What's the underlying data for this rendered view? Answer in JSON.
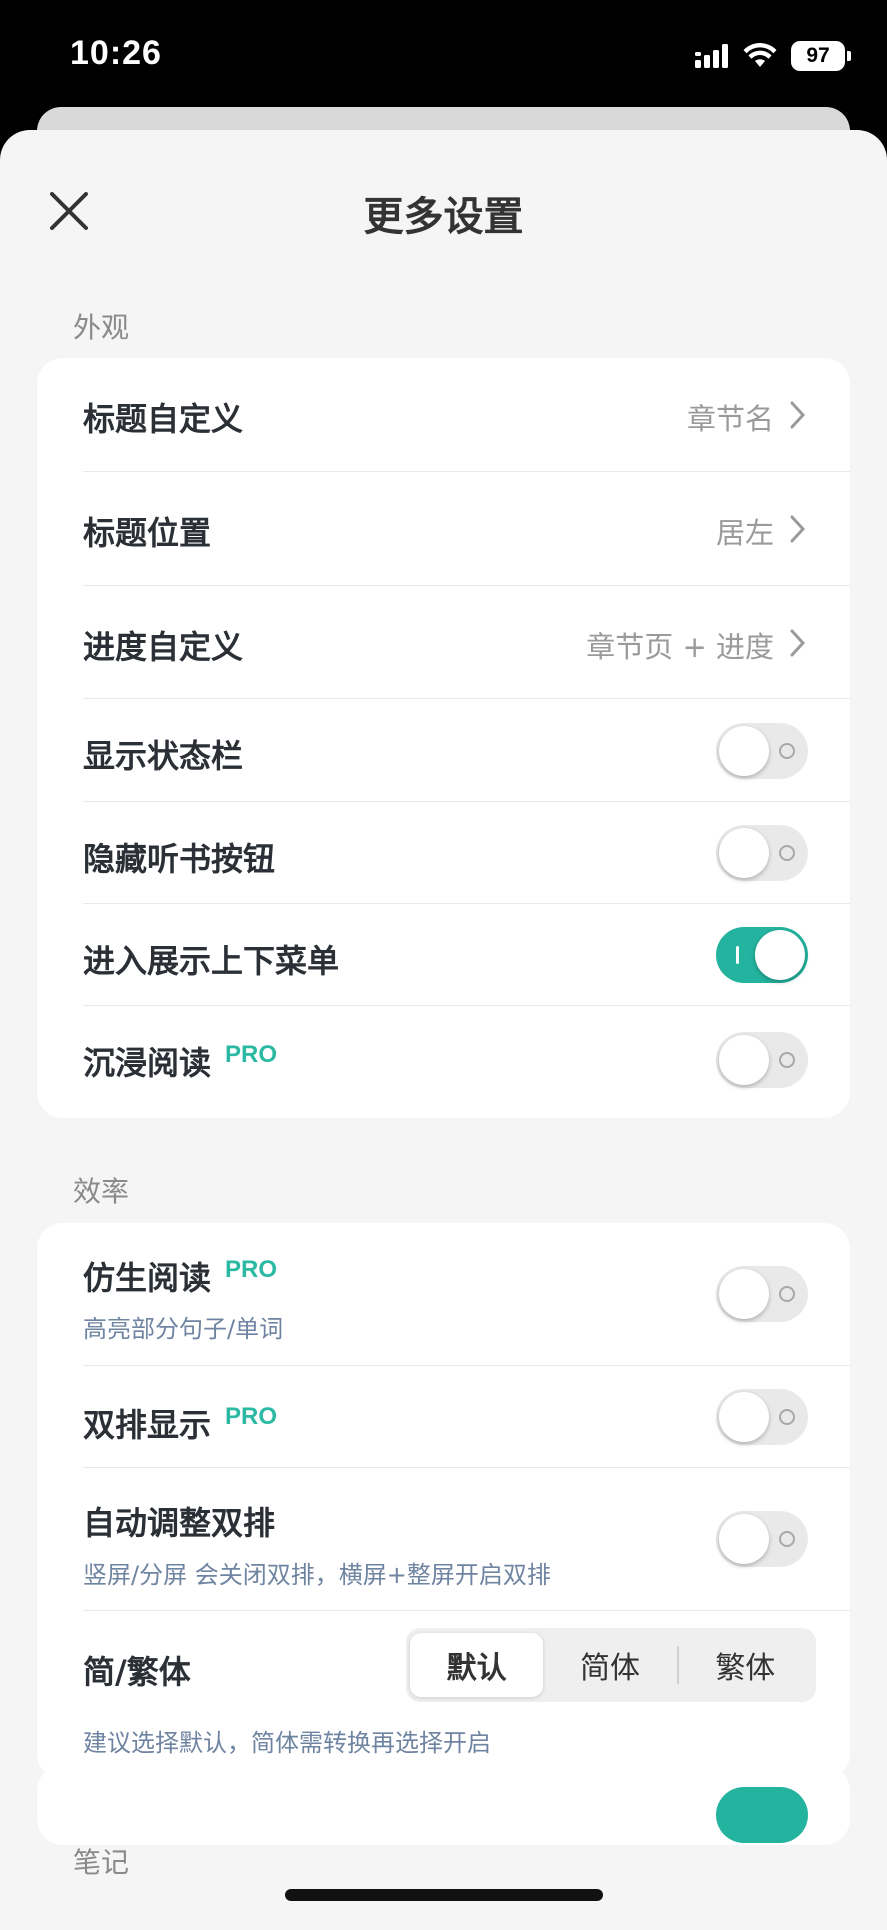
{
  "status_bar": {
    "time": "10:26",
    "battery": "97"
  },
  "header": {
    "title": "更多设置",
    "close_icon": "close-icon"
  },
  "sections": {
    "appearance": {
      "label": "外观",
      "title_custom": {
        "label": "标题自定义",
        "value": "章节名"
      },
      "title_position": {
        "label": "标题位置",
        "value": "居左"
      },
      "progress_custom": {
        "label": "进度自定义",
        "value": "章节页 + 进度"
      },
      "show_status_bar": {
        "label": "显示状态栏",
        "on": false
      },
      "hide_listen_button": {
        "label": "隐藏听书按钮",
        "on": false
      },
      "show_menus_on_enter": {
        "label": "进入展示上下菜单",
        "on": true
      },
      "immersive_reading": {
        "label": "沉浸阅读",
        "badge": "PRO",
        "on": false
      }
    },
    "efficiency": {
      "label": "效率",
      "bionic_reading": {
        "label": "仿生阅读",
        "badge": "PRO",
        "sub": "高亮部分句子/单词",
        "on": false
      },
      "dual_column": {
        "label": "双排显示",
        "badge": "PRO",
        "on": false
      },
      "auto_dual_column": {
        "label": "自动调整双排",
        "sub": "竖屏/分屏 会关闭双排，横屏+整屏开启双排",
        "on": false
      },
      "script_mode": {
        "label": "简/繁体",
        "options": [
          "默认",
          "简体",
          "繁体"
        ],
        "selected": "默认",
        "hint": "建议选择默认，简体需转换再选择开启"
      }
    },
    "notes": {
      "label": "笔记"
    }
  },
  "colors": {
    "accent": "#24b39e",
    "pro": "#2bb9a3",
    "sub_text": "#6f84a1",
    "background": "#f5f5f5"
  }
}
